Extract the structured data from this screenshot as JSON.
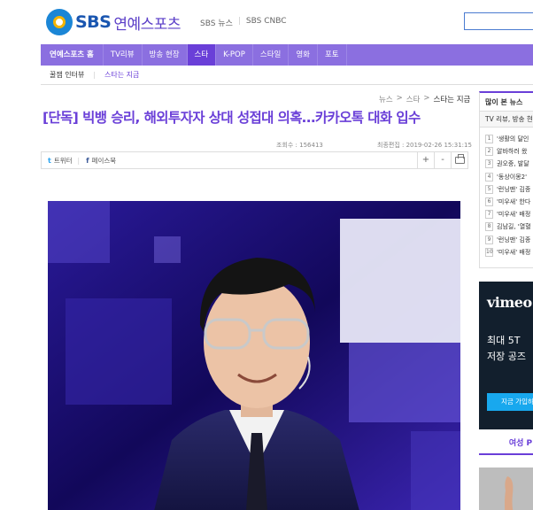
{
  "header": {
    "logo_text": "SBS",
    "site_title": "연예스포츠",
    "top_links": [
      "SBS 뉴스",
      "SBS CNBC"
    ]
  },
  "nav": {
    "items": [
      {
        "label": "연예스포츠 홈"
      },
      {
        "label": "TV리뷰"
      },
      {
        "label": "방송 현장"
      },
      {
        "label": "스타"
      },
      {
        "label": "K-POP"
      },
      {
        "label": "스타일"
      },
      {
        "label": "영화"
      },
      {
        "label": "포토"
      }
    ],
    "active_index": 3,
    "sub_items": [
      {
        "label": "꿀잼 인터뷰"
      },
      {
        "label": "스타는 지금"
      }
    ]
  },
  "breadcrumb": [
    "뉴스",
    "스타",
    "스타는 지금"
  ],
  "article": {
    "headline": "[단독] 빅뱅 승리, 해외투자자 상대 성접대 의혹…카카오톡 대화 입수",
    "views": "조회수 : 156413",
    "updated": "최종편집 : 2019-02-26 15:31:15"
  },
  "share": {
    "twitter": "트위터",
    "facebook": "페이스북",
    "zoom_in": "+",
    "zoom_out": "-"
  },
  "sidebar": {
    "title": "많이 본 뉴스",
    "tab": "TV 리뷰, 방송 현",
    "ranks": [
      {
        "num": "1",
        "title": "'생활의 달인"
      },
      {
        "num": "2",
        "title": "알바하러 왔"
      },
      {
        "num": "3",
        "title": "권오중, 발달"
      },
      {
        "num": "4",
        "title": "'동상이몽2'"
      },
      {
        "num": "5",
        "title": "'런닝맨' 김종"
      },
      {
        "num": "6",
        "title": "'미우새' 한다"
      },
      {
        "num": "7",
        "title": "'미우새' 배정"
      },
      {
        "num": "8",
        "title": "김남길, '열혈"
      },
      {
        "num": "9",
        "title": "'런닝맨' 김종"
      },
      {
        "num": "10",
        "title": "'미우새' 배정"
      }
    ],
    "ad": {
      "brand": "vimeo",
      "line1": "최대 5T",
      "line2": "저장 공즈",
      "button": "지금 가입하"
    },
    "bottom_tab": "여성 P"
  }
}
